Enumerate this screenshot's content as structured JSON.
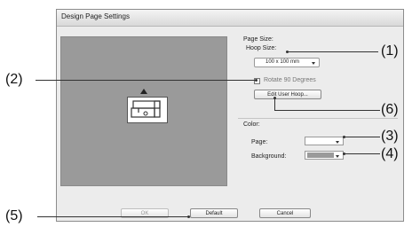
{
  "dialog": {
    "title": "Design Page Settings"
  },
  "page_size": {
    "group_label": "Page Size:",
    "hoop_size_label": "Hoop Size:",
    "hoop_size_value": "100 x 100 mm",
    "rotate_label": "Rotate 90 Degrees",
    "edit_user_hoop_label": "Edit User Hoop..."
  },
  "color": {
    "group_label": "Color:",
    "page_label": "Page:",
    "page_color": "#ffffff",
    "background_label": "Background:",
    "background_color": "#9a9a9a"
  },
  "buttons": {
    "ok_label": "OK",
    "default_label": "Default",
    "cancel_label": "Cancel"
  },
  "callouts": {
    "c1": "(1)",
    "c2": "(2)",
    "c3": "(3)",
    "c4": "(4)",
    "c5": "(5)",
    "c6": "(6)"
  }
}
